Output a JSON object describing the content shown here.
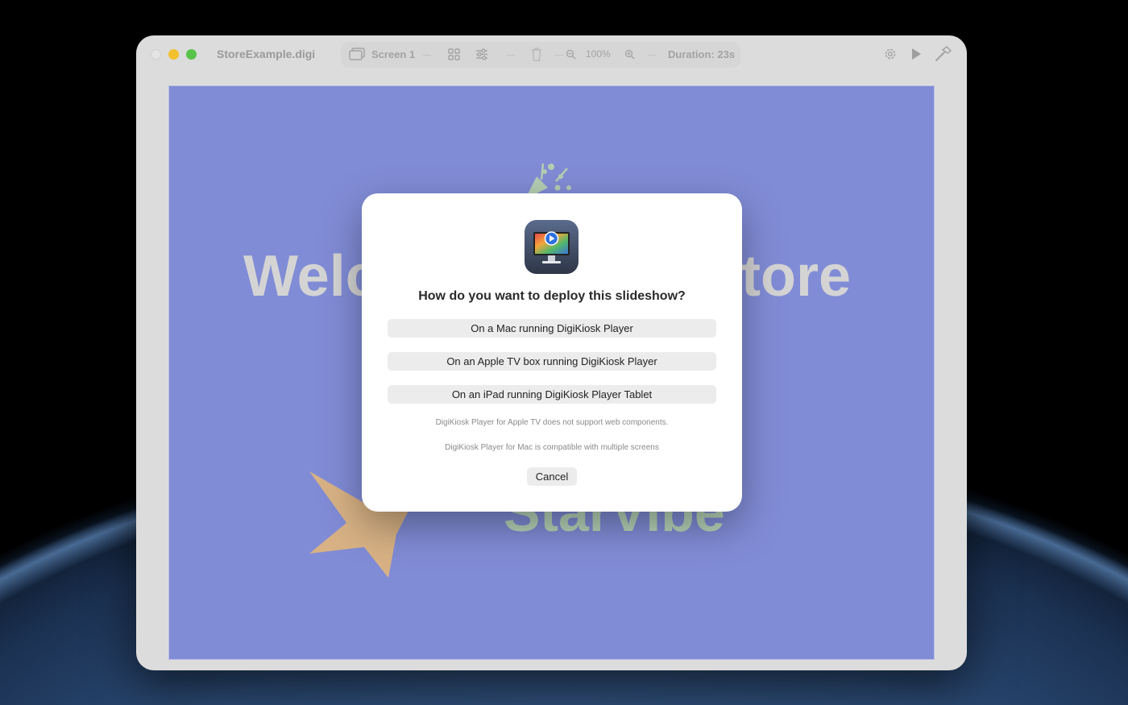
{
  "window": {
    "title": "StoreExample.digi",
    "screen_label": "Screen 1",
    "zoom": "100%",
    "duration": "Duration: 23s"
  },
  "canvas": {
    "headline_left": "Welc",
    "headline_right": "tore",
    "brand_text": "StarVibe",
    "background_color": "#818cd6"
  },
  "dialog": {
    "title": "How do you want to deploy this slideshow?",
    "options": [
      "On a Mac running DigiKiosk Player",
      "On an Apple TV box running DigiKiosk Player",
      "On an iPad running DigiKiosk Player Tablet"
    ],
    "notes": [
      "DigiKiosk Player for Apple TV does not support web components.",
      "DigiKiosk Player for Mac is compatible with multiple screens"
    ],
    "cancel_label": "Cancel"
  },
  "icons": {
    "toolbar": [
      "screens-icon",
      "grid-icon",
      "sliders-icon",
      "trash-icon",
      "zoom-out-icon",
      "zoom-in-icon"
    ],
    "right": [
      "gear-icon",
      "play-icon",
      "hammer-icon"
    ],
    "app": "digikiosk-app-icon"
  },
  "colors": {
    "close": "#e3e3e3",
    "minimize": "#f2c02d",
    "maximize": "#58c34a"
  }
}
